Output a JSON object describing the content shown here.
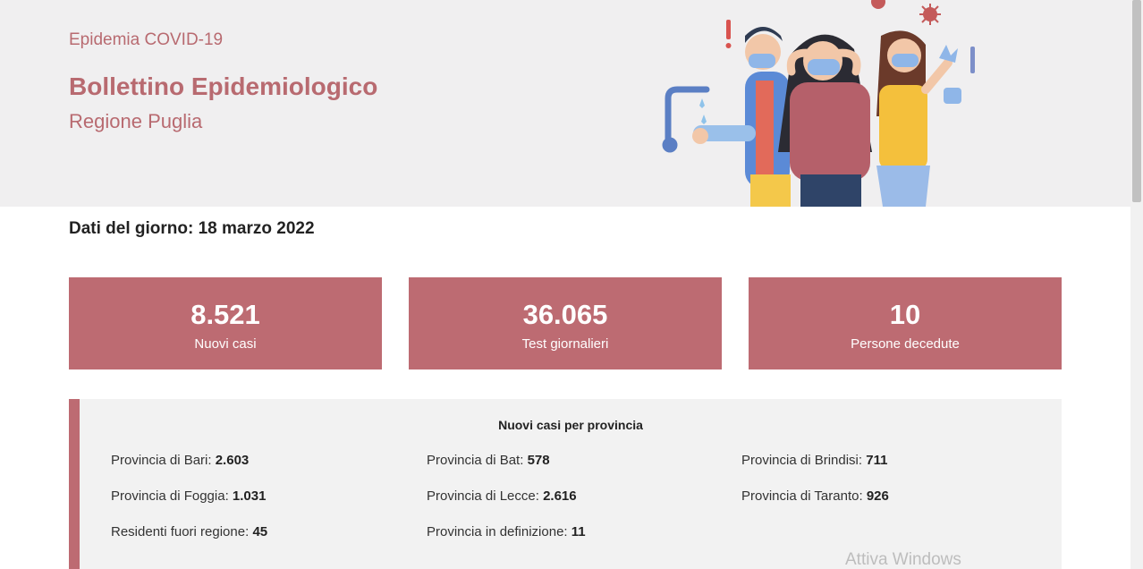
{
  "hero": {
    "kicker": "Epidemia COVID-19",
    "title": "Bollettino Epidemiologico",
    "subtitle": "Regione Puglia"
  },
  "date_line": "Dati del giorno: 18 marzo 2022",
  "stats": [
    {
      "value": "8.521",
      "label": "Nuovi casi"
    },
    {
      "value": "36.065",
      "label": "Test giornalieri"
    },
    {
      "value": "10",
      "label": "Persone decedute"
    }
  ],
  "provinces": {
    "title": "Nuovi casi per provincia",
    "items": [
      {
        "label": "Provincia di Bari:",
        "value": "2.603"
      },
      {
        "label": "Provincia di Bat:",
        "value": "578"
      },
      {
        "label": "Provincia di Brindisi:",
        "value": "711"
      },
      {
        "label": "Provincia di Foggia:",
        "value": "1.031"
      },
      {
        "label": "Provincia di Lecce:",
        "value": "2.616"
      },
      {
        "label": "Provincia di Taranto:",
        "value": "926"
      },
      {
        "label": "Residenti fuori regione:",
        "value": "45"
      },
      {
        "label": "Provincia in definizione:",
        "value": "11"
      }
    ]
  },
  "watermark": "Attiva Windows",
  "colors": {
    "accent": "#bd6b72",
    "hero_bg": "#f0eff0",
    "title": "#b86a70"
  },
  "illustration_icon": "people-with-masks-illustration"
}
